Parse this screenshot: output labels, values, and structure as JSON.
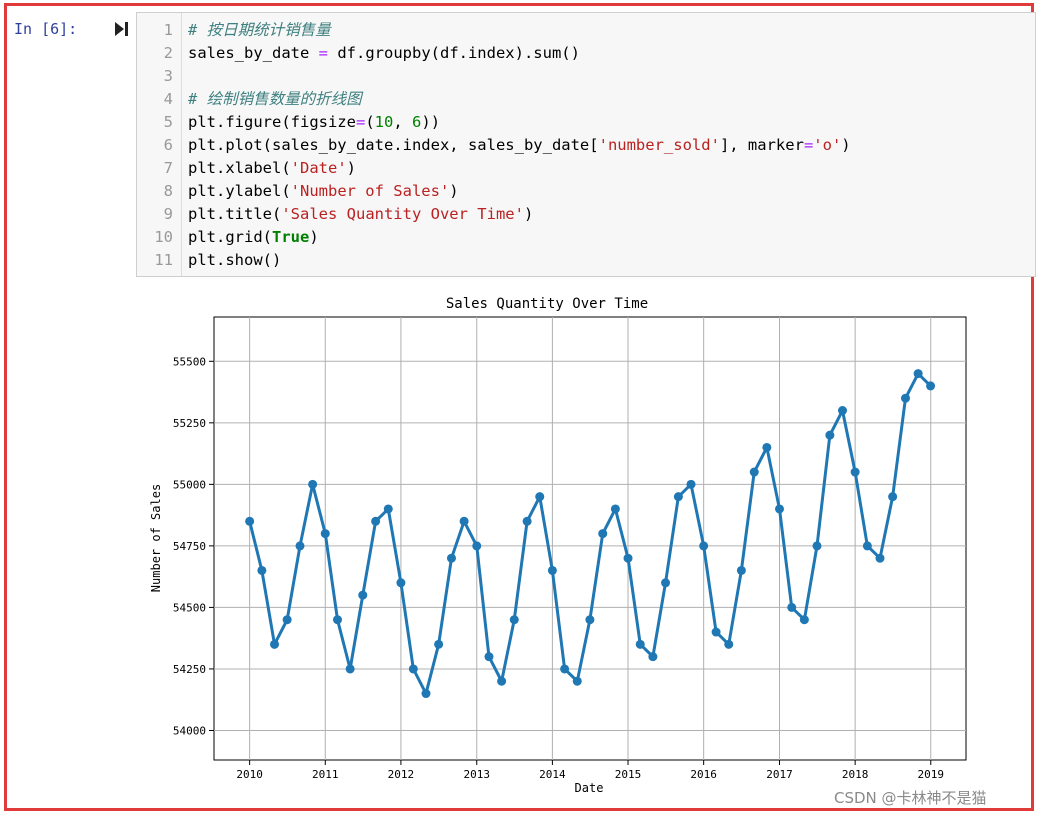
{
  "cell": {
    "prompt": "In  [6]:",
    "lines": [
      {
        "n": "1",
        "tokens": [
          {
            "t": "cm",
            "v": "# 按日期统计销售量"
          }
        ]
      },
      {
        "n": "2",
        "tokens": [
          {
            "t": "",
            "v": "sales_by_date "
          },
          {
            "t": "op",
            "v": "="
          },
          {
            "t": "",
            "v": " df.groupby(df.index).sum()"
          }
        ]
      },
      {
        "n": "3",
        "tokens": []
      },
      {
        "n": "4",
        "tokens": [
          {
            "t": "cm",
            "v": "# 绘制销售数量的折线图"
          }
        ]
      },
      {
        "n": "5",
        "tokens": [
          {
            "t": "",
            "v": "plt.figure(figsize"
          },
          {
            "t": "op",
            "v": "="
          },
          {
            "t": "",
            "v": "("
          },
          {
            "t": "num",
            "v": "10"
          },
          {
            "t": "",
            "v": ", "
          },
          {
            "t": "num",
            "v": "6"
          },
          {
            "t": "",
            "v": "))"
          }
        ]
      },
      {
        "n": "6",
        "tokens": [
          {
            "t": "",
            "v": "plt.plot(sales_by_date.index, sales_by_date["
          },
          {
            "t": "str",
            "v": "'number_sold'"
          },
          {
            "t": "",
            "v": "], marker"
          },
          {
            "t": "op",
            "v": "="
          },
          {
            "t": "str",
            "v": "'o'"
          },
          {
            "t": "",
            "v": ")"
          }
        ]
      },
      {
        "n": "7",
        "tokens": [
          {
            "t": "",
            "v": "plt.xlabel("
          },
          {
            "t": "str",
            "v": "'Date'"
          },
          {
            "t": "",
            "v": ")"
          }
        ]
      },
      {
        "n": "8",
        "tokens": [
          {
            "t": "",
            "v": "plt.ylabel("
          },
          {
            "t": "str",
            "v": "'Number of Sales'"
          },
          {
            "t": "",
            "v": ")"
          }
        ]
      },
      {
        "n": "9",
        "tokens": [
          {
            "t": "",
            "v": "plt.title("
          },
          {
            "t": "str",
            "v": "'Sales Quantity Over Time'"
          },
          {
            "t": "",
            "v": ")"
          }
        ]
      },
      {
        "n": "10",
        "tokens": [
          {
            "t": "",
            "v": "plt.grid("
          },
          {
            "t": "kw",
            "v": "True"
          },
          {
            "t": "",
            "v": ")"
          }
        ]
      },
      {
        "n": "11",
        "tokens": [
          {
            "t": "",
            "v": "plt.show()"
          }
        ]
      }
    ]
  },
  "icons": {
    "run": "run-cell-icon"
  },
  "colors": {
    "series": "#1f77b4",
    "frame": "#e03a3a",
    "prompt": "#303f9f"
  },
  "watermark": "CSDN @卡林神不是猫",
  "chart_data": {
    "type": "line",
    "title": "Sales Quantity Over Time",
    "xlabel": "Date",
    "ylabel": "Number of Sales",
    "x_tick_labels": [
      "2010",
      "2011",
      "2012",
      "2013",
      "2014",
      "2015",
      "2016",
      "2017",
      "2018",
      "2019"
    ],
    "y_tick_labels": [
      "54000",
      "54250",
      "54500",
      "54750",
      "55000",
      "55250",
      "55500"
    ],
    "xlim": [
      "2009-07-13",
      "2019-06-20"
    ],
    "ylim": [
      53880,
      55680
    ],
    "grid": true,
    "marker": "o",
    "series": [
      {
        "x": [
          "2010-01-01",
          "2010-03-01",
          "2010-05-01",
          "2010-07-01",
          "2010-09-01",
          "2010-11-01",
          "2011-01-01",
          "2011-03-01",
          "2011-05-01",
          "2011-07-01",
          "2011-09-01",
          "2011-11-01",
          "2012-01-01",
          "2012-03-01",
          "2012-05-01",
          "2012-07-01",
          "2012-09-01",
          "2012-11-01",
          "2013-01-01",
          "2013-03-01",
          "2013-05-01",
          "2013-07-01",
          "2013-09-01",
          "2013-11-01",
          "2014-01-01",
          "2014-03-01",
          "2014-05-01",
          "2014-07-01",
          "2014-09-01",
          "2014-11-01",
          "2015-01-01",
          "2015-03-01",
          "2015-05-01",
          "2015-07-01",
          "2015-09-01",
          "2015-11-01",
          "2016-01-01",
          "2016-03-01",
          "2016-05-01",
          "2016-07-01",
          "2016-09-01",
          "2016-11-01",
          "2017-01-01",
          "2017-03-01",
          "2017-05-01",
          "2017-07-01",
          "2017-09-01",
          "2017-11-01",
          "2018-01-01",
          "2018-03-01",
          "2018-05-01",
          "2018-07-01",
          "2018-09-01",
          "2018-11-01",
          "2018-12-31"
        ],
        "y": [
          54850,
          54650,
          54350,
          54450,
          54750,
          55000,
          54800,
          54450,
          54250,
          54550,
          54850,
          54900,
          54600,
          54250,
          54150,
          54350,
          54700,
          54850,
          54750,
          54300,
          54200,
          54450,
          54850,
          54950,
          54650,
          54250,
          54200,
          54450,
          54800,
          54900,
          54700,
          54350,
          54300,
          54600,
          54950,
          55000,
          54750,
          54400,
          54350,
          54650,
          55050,
          55150,
          54900,
          54500,
          54450,
          54750,
          55200,
          55300,
          55050,
          54750,
          54700,
          54950,
          55350,
          55450,
          55400
        ]
      }
    ]
  }
}
